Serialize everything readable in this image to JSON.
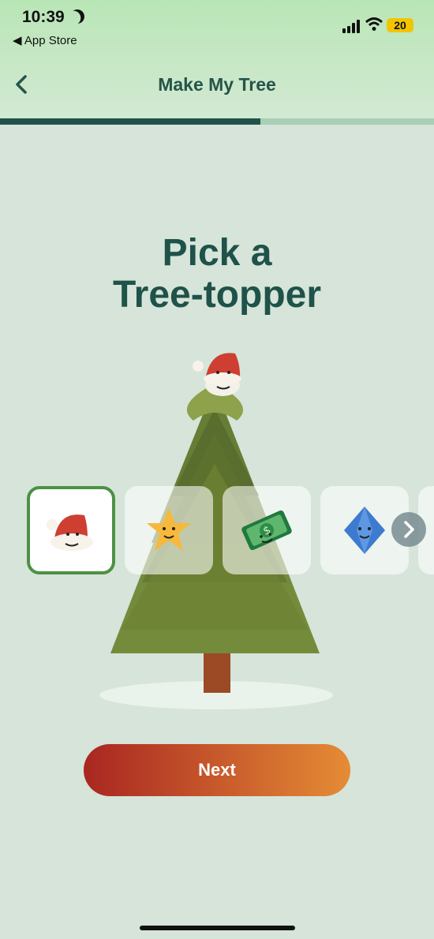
{
  "status_bar": {
    "time": "10:39",
    "back_app_label": "◀ App Store",
    "battery": "20"
  },
  "nav": {
    "title": "Make My Tree",
    "back_icon": "chevron-left-icon"
  },
  "progress": {
    "fraction": 0.6
  },
  "heading": {
    "line1": "Pick a",
    "line2": "Tree-topper"
  },
  "toppers": {
    "options": [
      {
        "name": "santa-hat",
        "selected": true
      },
      {
        "name": "star",
        "selected": false
      },
      {
        "name": "dollar-bill",
        "selected": false
      },
      {
        "name": "blue-gem",
        "selected": false
      }
    ]
  },
  "actions": {
    "next_label": "Next"
  },
  "colors": {
    "accent": "#22534b",
    "selected_border": "#4d9144",
    "button_start": "#a92621",
    "button_end": "#e58c35"
  }
}
